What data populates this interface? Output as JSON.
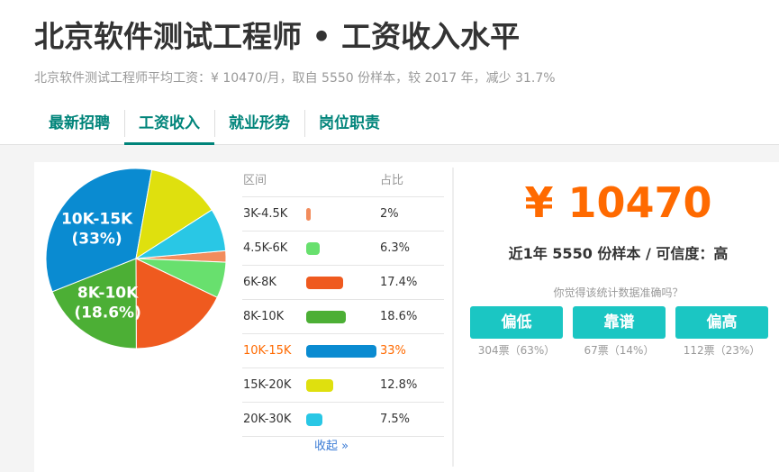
{
  "header": {
    "title": "北京软件测试工程师 • 工资收入水平",
    "subtitle": "北京软件测试工程师平均工资：¥ 10470/月，取自 5550 份样本，较 2017 年，减少 31.7%"
  },
  "tabs": [
    {
      "label": "最新招聘",
      "active": false
    },
    {
      "label": "工资收入",
      "active": true
    },
    {
      "label": "就业形势",
      "active": false
    },
    {
      "label": "岗位职责",
      "active": false
    }
  ],
  "table": {
    "col_range": "区间",
    "col_share": "占比",
    "collapse_label": "收起 »"
  },
  "summary": {
    "salary": "¥ 10470",
    "sample_line": "近1年 5550 份样本 / 可信度：高",
    "question": "你觉得该统计数据准确吗？",
    "votes": [
      {
        "label": "偏低",
        "count": "304票（63%）"
      },
      {
        "label": "靠谱",
        "count": "67票（14%）"
      },
      {
        "label": "偏高",
        "count": "112票（23%）"
      }
    ]
  },
  "chart_data": {
    "type": "pie",
    "slices": [
      {
        "range": "3K-4.5K",
        "value": 2,
        "label": "2%",
        "color": "#f28c5c"
      },
      {
        "range": "4.5K-6K",
        "value": 6.3,
        "label": "6.3%",
        "color": "#68e06e"
      },
      {
        "range": "6K-8K",
        "value": 17.4,
        "label": "17.4%",
        "color": "#ef5a1f"
      },
      {
        "range": "8K-10K",
        "value": 18.6,
        "label": "18.6%",
        "color": "#4caf35"
      },
      {
        "range": "10K-15K",
        "value": 33,
        "label": "33%",
        "color": "#0a8bd1",
        "highlight": true
      },
      {
        "range": "15K-20K",
        "value": 12.8,
        "label": "12.8%",
        "color": "#dfe00e"
      },
      {
        "range": "20K-30K",
        "value": 7.5,
        "label": "7.5%",
        "color": "#29c7e5"
      }
    ],
    "pie_labels": [
      {
        "range": "10K-15K",
        "line1": "10K-15K",
        "line2": "(33%)"
      },
      {
        "range": "8K-10K",
        "line1": "8K-10K",
        "line2": "(18.6%)"
      }
    ]
  }
}
